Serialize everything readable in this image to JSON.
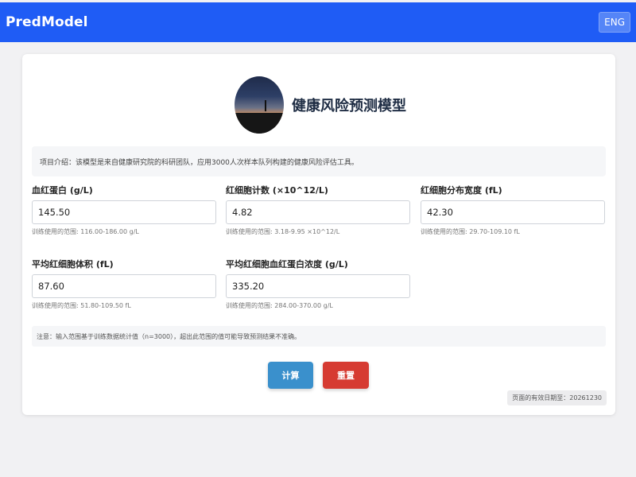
{
  "header": {
    "brand": "PredModel",
    "lang_button": "ENG",
    "bg_color": "#1f5cf5"
  },
  "main": {
    "title": "健康风险预测模型",
    "intro": "项目介绍：该模型是来自健康研究院的科研团队，应用3000人次样本队列构建的健康风险评估工具。",
    "fields": [
      {
        "label": "血红蛋白 (g/L)",
        "value": "145.50",
        "hint": "训练使用的范围: 116.00-186.00 g/L"
      },
      {
        "label": "红细胞计数 (×10^12/L)",
        "value": "4.82",
        "hint": "训练使用的范围: 3.18-9.95 ×10^12/L"
      },
      {
        "label": "红细胞分布宽度 (fL)",
        "value": "42.30",
        "hint": "训练使用的范围: 29.70-109.10 fL"
      },
      {
        "label": "平均红细胞体积 (fL)",
        "value": "87.60",
        "hint": "训练使用的范围: 51.80-109.50 fL"
      },
      {
        "label": "平均红细胞血红蛋白浓度 (g/L)",
        "value": "335.20",
        "hint": "训练使用的范围: 284.00-370.00 g/L"
      }
    ],
    "note": "注意：输入范围基于训练数据统计值（n=3000），超出此范围的值可能导致预测结果不准确。",
    "buttons": {
      "calculate": "计算",
      "reset": "重置",
      "calculate_color": "#3a90cc",
      "reset_color": "#d63b32"
    },
    "expiry": "页面的有效日期至：20261230"
  }
}
